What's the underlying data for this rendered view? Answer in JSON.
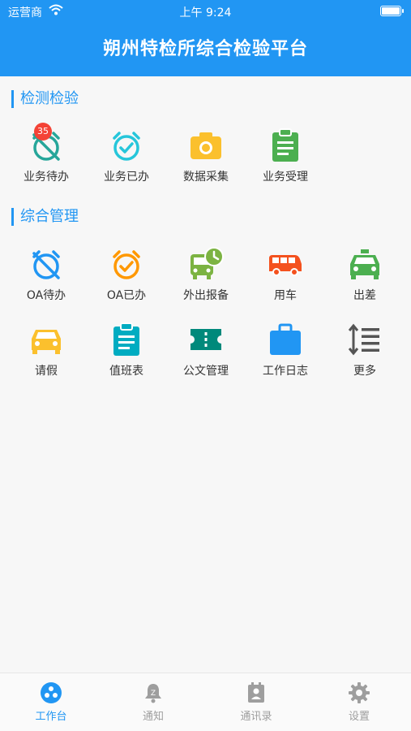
{
  "status_bar": {
    "carrier": "运营商",
    "time": "上午 9:24"
  },
  "header": {
    "title": "朔州特检所综合检验平台"
  },
  "sections": [
    {
      "title": "检测检验",
      "items": [
        {
          "label": "业务待办",
          "icon": "alarm-off-icon",
          "color": "#26a69a",
          "badge": "35"
        },
        {
          "label": "业务已办",
          "icon": "alarm-check-icon",
          "color": "#26c6da"
        },
        {
          "label": "数据采集",
          "icon": "camera-icon",
          "color": "#fbc02d"
        },
        {
          "label": "业务受理",
          "icon": "clipboard-icon",
          "color": "#4caf50"
        }
      ]
    },
    {
      "title": "综合管理",
      "items": [
        {
          "label": "OA待办",
          "icon": "alarm-off-icon",
          "color": "#2196f3"
        },
        {
          "label": "OA已办",
          "icon": "alarm-check-icon",
          "color": "#ff9800"
        },
        {
          "label": "外出报备",
          "icon": "bus-clock-icon",
          "color": "#7cb342"
        },
        {
          "label": "用车",
          "icon": "van-icon",
          "color": "#f4511e"
        },
        {
          "label": "出差",
          "icon": "taxi-icon",
          "color": "#4caf50"
        },
        {
          "label": "请假",
          "icon": "car-icon",
          "color": "#fbc02d"
        },
        {
          "label": "值班表",
          "icon": "clipboard-text-icon",
          "color": "#00acc1"
        },
        {
          "label": "公文管理",
          "icon": "ticket-icon",
          "color": "#00897b"
        },
        {
          "label": "工作日志",
          "icon": "briefcase-icon",
          "color": "#2196f3"
        },
        {
          "label": "更多",
          "icon": "sort-lines-icon",
          "color": "#555555"
        }
      ]
    }
  ],
  "tabs": [
    {
      "label": "工作台",
      "icon": "workbench-icon",
      "active": true
    },
    {
      "label": "通知",
      "icon": "bell-icon"
    },
    {
      "label": "通讯录",
      "icon": "contacts-icon"
    },
    {
      "label": "设置",
      "icon": "gear-icon"
    }
  ],
  "colors": {
    "primary": "#2196f3",
    "inactive": "#9e9e9e"
  }
}
